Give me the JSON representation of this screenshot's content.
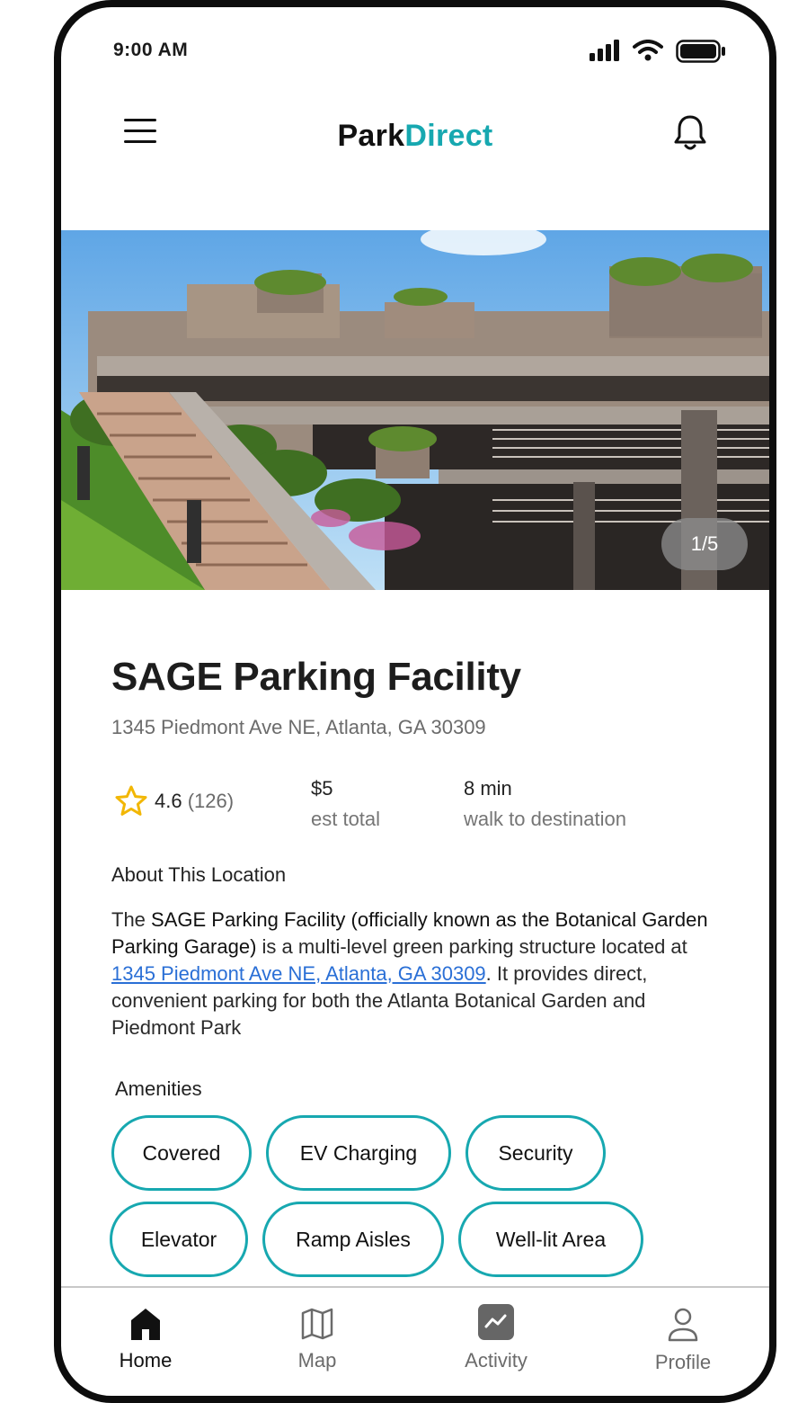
{
  "status_bar": {
    "time": "9:00 AM"
  },
  "header": {
    "logo_part1": "Park",
    "logo_part2": "Direct"
  },
  "hero": {
    "image_counter": "1/5"
  },
  "facility": {
    "name": "SAGE Parking Facility",
    "address": "1345 Piedmont Ave NE, Atlanta, GA 30309",
    "rating": "4.6",
    "review_count": "(126)",
    "price": "$5",
    "price_label": "est total",
    "walk_time": "8 min",
    "walk_label": "walk to destination"
  },
  "about": {
    "heading": "About This Location",
    "text_1": "The ",
    "text_bold": "SAGE Parking Facility (officially known as the Botanical Garden Parking Garage)",
    "text_2": " is a multi-level green parking structure located at ",
    "link": "1345 Piedmont Ave NE, Atlanta, GA 30309",
    "text_3": ". It provides direct, convenient parking for both the Atlanta Botanical Garden and Piedmont Park"
  },
  "amenities": {
    "heading": "Amenities",
    "items": [
      "Covered",
      "EV Charging",
      "Security",
      "Elevator",
      "Ramp Aisles",
      "Well-lit Area"
    ]
  },
  "nav": {
    "items": [
      {
        "label": "Home",
        "icon": "home-icon",
        "active": true
      },
      {
        "label": "Map",
        "icon": "map-icon",
        "active": false
      },
      {
        "label": "Activity",
        "icon": "activity-icon",
        "active": false
      },
      {
        "label": "Profile",
        "icon": "profile-icon",
        "active": false
      }
    ]
  },
  "colors": {
    "accent": "#17a8b0",
    "link": "#2a6fd6",
    "star": "#f2b705"
  }
}
